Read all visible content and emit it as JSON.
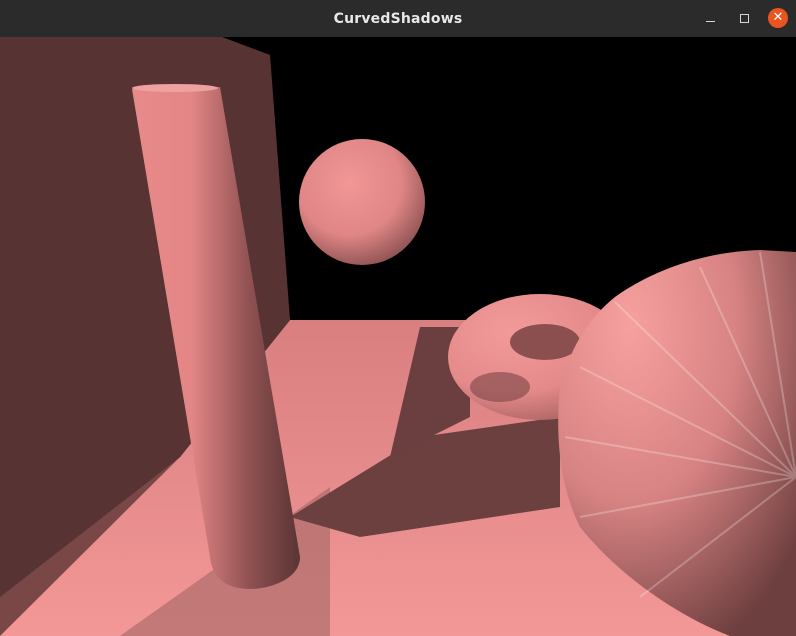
{
  "window": {
    "title": "CurvedShadows",
    "controls": {
      "minimize_icon": "minimize-icon",
      "maximize_icon": "maximize-icon",
      "close_icon": "close-icon",
      "close_glyph": "✕",
      "close_color": "#e95420"
    }
  },
  "scene": {
    "background_color": "#000000",
    "material_color": "#f08a8a",
    "objects": [
      "wall",
      "floor",
      "cylinder",
      "sphere",
      "torus",
      "cone"
    ]
  }
}
